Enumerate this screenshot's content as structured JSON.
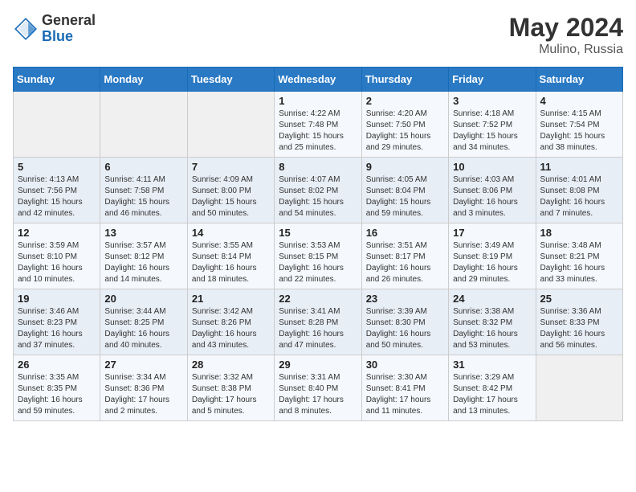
{
  "header": {
    "logo_general": "General",
    "logo_blue": "Blue",
    "title": "May 2024",
    "location": "Mulino, Russia"
  },
  "days_of_week": [
    "Sunday",
    "Monday",
    "Tuesday",
    "Wednesday",
    "Thursday",
    "Friday",
    "Saturday"
  ],
  "weeks": [
    [
      {
        "day": "",
        "info": ""
      },
      {
        "day": "",
        "info": ""
      },
      {
        "day": "",
        "info": ""
      },
      {
        "day": "1",
        "info": "Sunrise: 4:22 AM\nSunset: 7:48 PM\nDaylight: 15 hours\nand 25 minutes."
      },
      {
        "day": "2",
        "info": "Sunrise: 4:20 AM\nSunset: 7:50 PM\nDaylight: 15 hours\nand 29 minutes."
      },
      {
        "day": "3",
        "info": "Sunrise: 4:18 AM\nSunset: 7:52 PM\nDaylight: 15 hours\nand 34 minutes."
      },
      {
        "day": "4",
        "info": "Sunrise: 4:15 AM\nSunset: 7:54 PM\nDaylight: 15 hours\nand 38 minutes."
      }
    ],
    [
      {
        "day": "5",
        "info": "Sunrise: 4:13 AM\nSunset: 7:56 PM\nDaylight: 15 hours\nand 42 minutes."
      },
      {
        "day": "6",
        "info": "Sunrise: 4:11 AM\nSunset: 7:58 PM\nDaylight: 15 hours\nand 46 minutes."
      },
      {
        "day": "7",
        "info": "Sunrise: 4:09 AM\nSunset: 8:00 PM\nDaylight: 15 hours\nand 50 minutes."
      },
      {
        "day": "8",
        "info": "Sunrise: 4:07 AM\nSunset: 8:02 PM\nDaylight: 15 hours\nand 54 minutes."
      },
      {
        "day": "9",
        "info": "Sunrise: 4:05 AM\nSunset: 8:04 PM\nDaylight: 15 hours\nand 59 minutes."
      },
      {
        "day": "10",
        "info": "Sunrise: 4:03 AM\nSunset: 8:06 PM\nDaylight: 16 hours\nand 3 minutes."
      },
      {
        "day": "11",
        "info": "Sunrise: 4:01 AM\nSunset: 8:08 PM\nDaylight: 16 hours\nand 7 minutes."
      }
    ],
    [
      {
        "day": "12",
        "info": "Sunrise: 3:59 AM\nSunset: 8:10 PM\nDaylight: 16 hours\nand 10 minutes."
      },
      {
        "day": "13",
        "info": "Sunrise: 3:57 AM\nSunset: 8:12 PM\nDaylight: 16 hours\nand 14 minutes."
      },
      {
        "day": "14",
        "info": "Sunrise: 3:55 AM\nSunset: 8:14 PM\nDaylight: 16 hours\nand 18 minutes."
      },
      {
        "day": "15",
        "info": "Sunrise: 3:53 AM\nSunset: 8:15 PM\nDaylight: 16 hours\nand 22 minutes."
      },
      {
        "day": "16",
        "info": "Sunrise: 3:51 AM\nSunset: 8:17 PM\nDaylight: 16 hours\nand 26 minutes."
      },
      {
        "day": "17",
        "info": "Sunrise: 3:49 AM\nSunset: 8:19 PM\nDaylight: 16 hours\nand 29 minutes."
      },
      {
        "day": "18",
        "info": "Sunrise: 3:48 AM\nSunset: 8:21 PM\nDaylight: 16 hours\nand 33 minutes."
      }
    ],
    [
      {
        "day": "19",
        "info": "Sunrise: 3:46 AM\nSunset: 8:23 PM\nDaylight: 16 hours\nand 37 minutes."
      },
      {
        "day": "20",
        "info": "Sunrise: 3:44 AM\nSunset: 8:25 PM\nDaylight: 16 hours\nand 40 minutes."
      },
      {
        "day": "21",
        "info": "Sunrise: 3:42 AM\nSunset: 8:26 PM\nDaylight: 16 hours\nand 43 minutes."
      },
      {
        "day": "22",
        "info": "Sunrise: 3:41 AM\nSunset: 8:28 PM\nDaylight: 16 hours\nand 47 minutes."
      },
      {
        "day": "23",
        "info": "Sunrise: 3:39 AM\nSunset: 8:30 PM\nDaylight: 16 hours\nand 50 minutes."
      },
      {
        "day": "24",
        "info": "Sunrise: 3:38 AM\nSunset: 8:32 PM\nDaylight: 16 hours\nand 53 minutes."
      },
      {
        "day": "25",
        "info": "Sunrise: 3:36 AM\nSunset: 8:33 PM\nDaylight: 16 hours\nand 56 minutes."
      }
    ],
    [
      {
        "day": "26",
        "info": "Sunrise: 3:35 AM\nSunset: 8:35 PM\nDaylight: 16 hours\nand 59 minutes."
      },
      {
        "day": "27",
        "info": "Sunrise: 3:34 AM\nSunset: 8:36 PM\nDaylight: 17 hours\nand 2 minutes."
      },
      {
        "day": "28",
        "info": "Sunrise: 3:32 AM\nSunset: 8:38 PM\nDaylight: 17 hours\nand 5 minutes."
      },
      {
        "day": "29",
        "info": "Sunrise: 3:31 AM\nSunset: 8:40 PM\nDaylight: 17 hours\nand 8 minutes."
      },
      {
        "day": "30",
        "info": "Sunrise: 3:30 AM\nSunset: 8:41 PM\nDaylight: 17 hours\nand 11 minutes."
      },
      {
        "day": "31",
        "info": "Sunrise: 3:29 AM\nSunset: 8:42 PM\nDaylight: 17 hours\nand 13 minutes."
      },
      {
        "day": "",
        "info": ""
      }
    ]
  ]
}
